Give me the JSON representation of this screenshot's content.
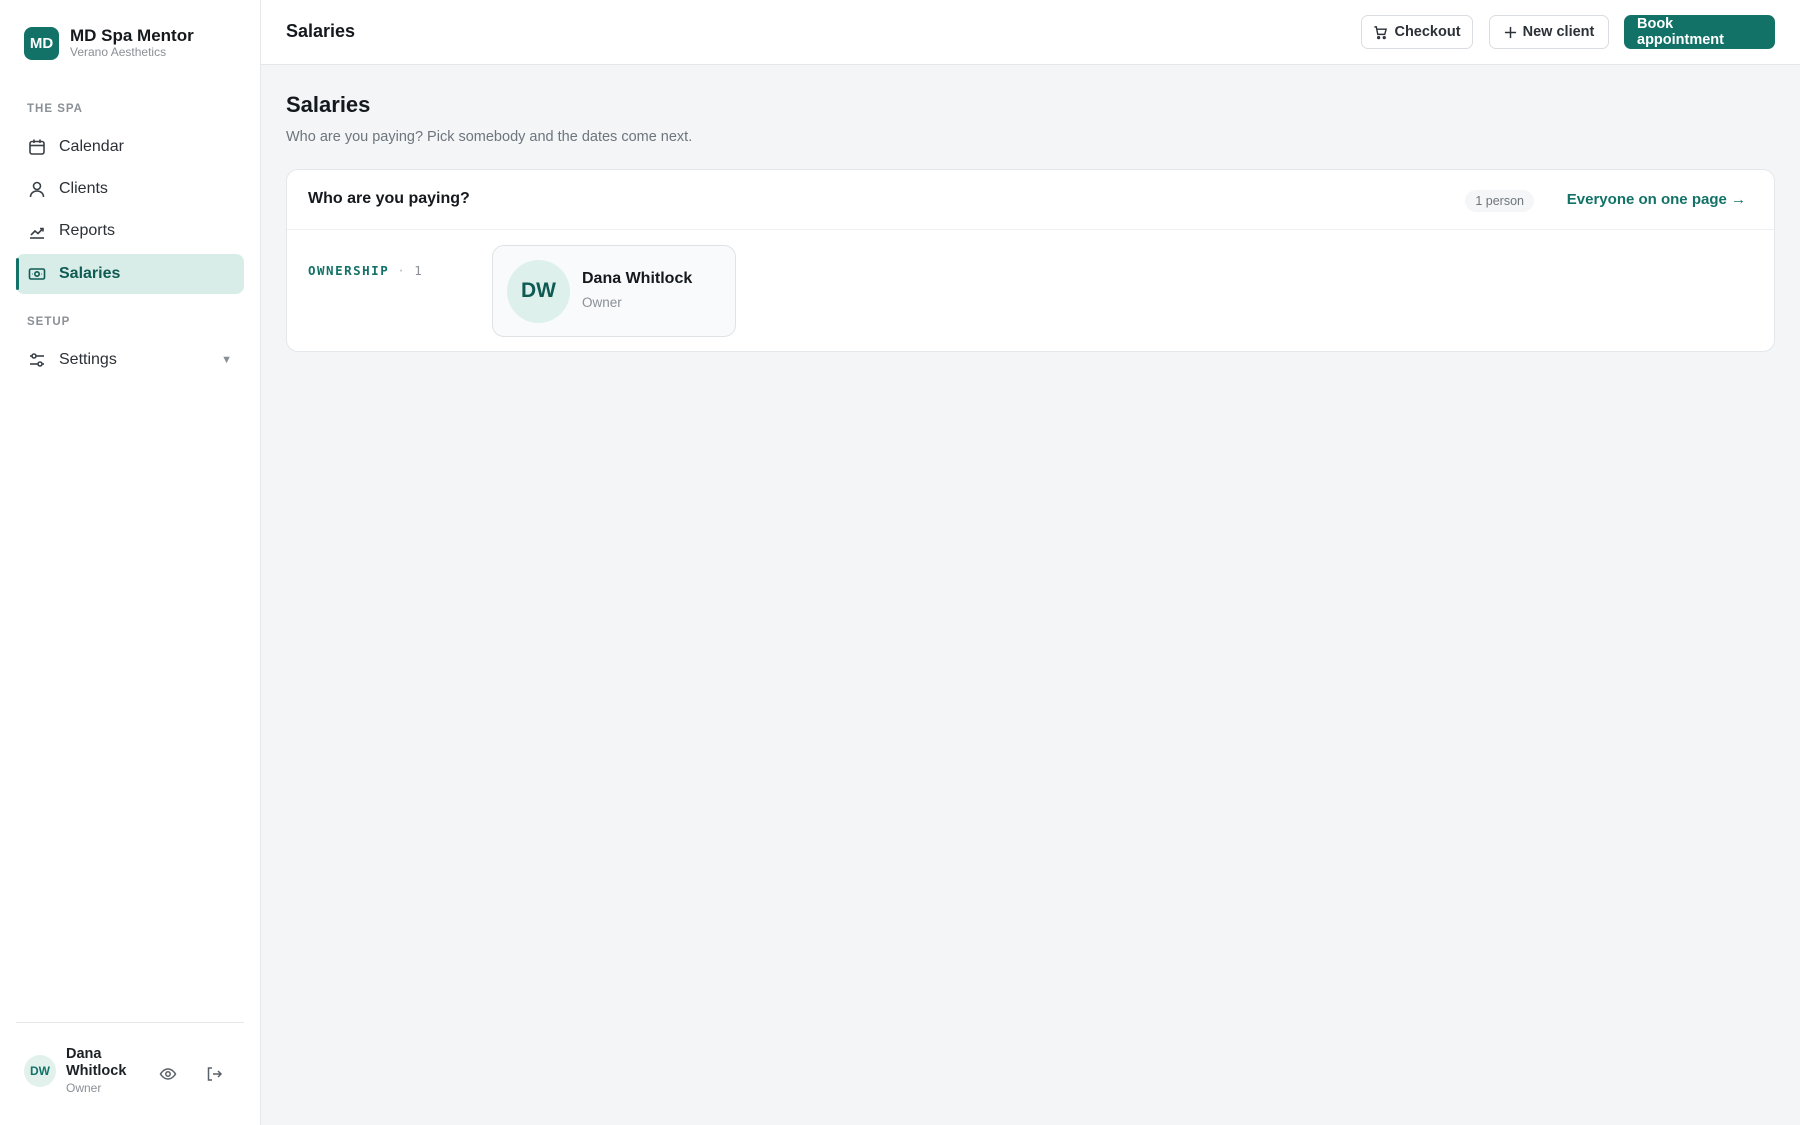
{
  "brand": {
    "logo_initials": "MD",
    "name": "MD Spa Mentor",
    "subtitle": "Verano Aesthetics"
  },
  "sidebar": {
    "section_spa": "THE SPA",
    "section_setup": "SETUP",
    "items": [
      {
        "label": "Calendar",
        "icon": "calendar-icon"
      },
      {
        "label": "Clients",
        "icon": "user-icon"
      },
      {
        "label": "Reports",
        "icon": "trend-chart-icon"
      },
      {
        "label": "Salaries",
        "icon": "money-icon",
        "active": true
      }
    ],
    "settings": {
      "label": "Settings",
      "icon": "sliders-icon",
      "chevron": "▼"
    }
  },
  "user": {
    "initials": "DW",
    "name": "Dana Whitlock",
    "role": "Owner"
  },
  "topbar": {
    "title": "Salaries",
    "checkout_label": "Checkout",
    "new_client_label": "New client",
    "book_label": "Book appointment"
  },
  "page": {
    "title": "Salaries",
    "subtitle": "Who are you paying? Pick somebody and the dates come next."
  },
  "card": {
    "title": "Who are you paying?",
    "count": "1 person",
    "link": "Everyone on one page →",
    "group": {
      "label": "OWNERSHIP",
      "separator": "·",
      "count": "1"
    },
    "people": [
      {
        "initials": "DW",
        "name": "Dana Whitlock",
        "role": "Owner"
      }
    ]
  },
  "colors": {
    "accent": "#137268",
    "active_bg": "#d8ede8",
    "page_bg": "#f3f5f7"
  }
}
